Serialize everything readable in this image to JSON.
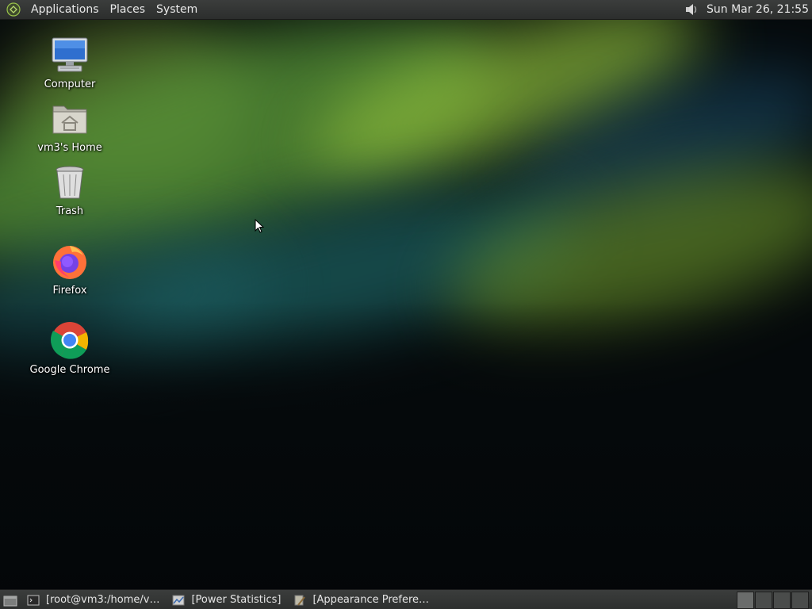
{
  "top_panel": {
    "menus": [
      "Applications",
      "Places",
      "System"
    ],
    "clock": "Sun Mar 26, 21:55",
    "icons": [
      "gnome-foot-icon",
      "volume-icon"
    ]
  },
  "desktop_icons": [
    {
      "label": "Computer",
      "icon": "computer-icon"
    },
    {
      "label": "vm3's Home",
      "icon": "home-folder-icon"
    },
    {
      "label": "Trash",
      "icon": "trash-icon"
    },
    {
      "label": "Firefox",
      "icon": "firefox-icon"
    },
    {
      "label": "Google Chrome",
      "icon": "chrome-icon"
    }
  ],
  "taskbar": {
    "tasks": [
      {
        "label": "[root@vm3:/home/v…",
        "icon": "terminal-icon"
      },
      {
        "label": "[Power Statistics]",
        "icon": "power-statistics-icon"
      },
      {
        "label": "[Appearance Prefere…",
        "icon": "appearance-icon"
      }
    ]
  },
  "colors": {
    "panel_bg": "#2f3130",
    "panel_text": "#e8e8e8"
  }
}
